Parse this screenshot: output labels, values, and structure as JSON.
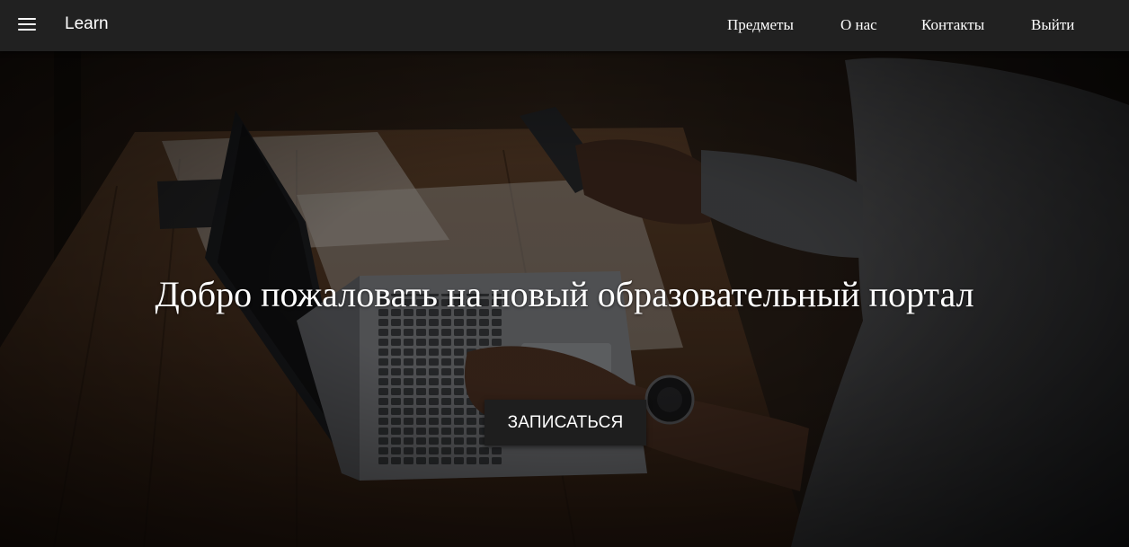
{
  "navbar": {
    "menu_icon": "hamburger-menu-icon",
    "brand": "Learn",
    "links": [
      "Предметы",
      "О нас",
      "Контакты",
      "Выйти"
    ]
  },
  "hero": {
    "title": "Добро пожаловать на новый образовательный портал",
    "button": "ЗАПИСАТЬСЯ",
    "background_image": "person-typing-on-laptop-holding-phone"
  },
  "colors": {
    "navbar": "#212121",
    "button": "#1e1e1e",
    "text": "#ffffff"
  }
}
